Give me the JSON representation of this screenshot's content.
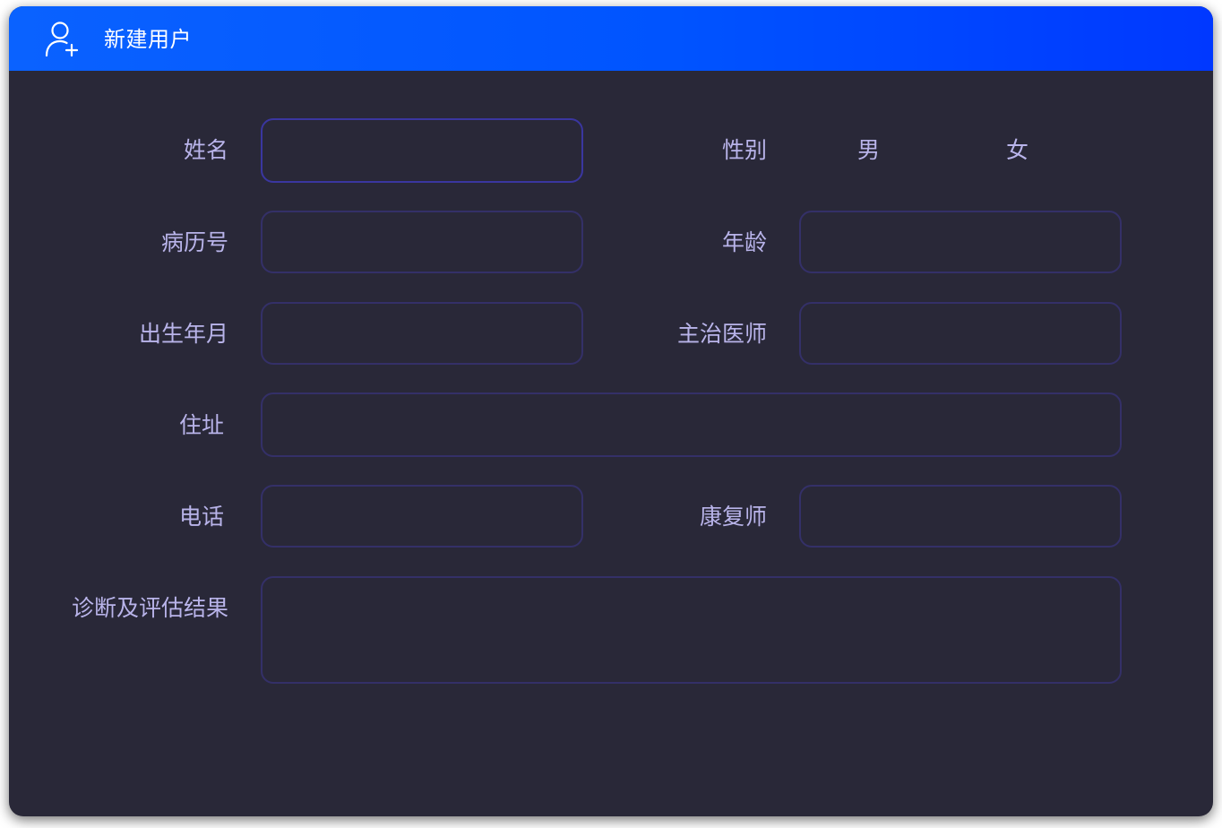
{
  "dialog": {
    "title": "新建用户",
    "title_icon": "add-user-icon"
  },
  "form": {
    "name": {
      "label": "姓名",
      "value": ""
    },
    "gender": {
      "label": "性别",
      "options": [
        "男",
        "女"
      ]
    },
    "record_no": {
      "label": "病历号",
      "value": ""
    },
    "age": {
      "label": "年龄",
      "value": ""
    },
    "birth": {
      "label": "出生年月",
      "value": ""
    },
    "doctor": {
      "label": "主治医师",
      "value": ""
    },
    "address": {
      "label": "住址",
      "value": ""
    },
    "phone": {
      "label": "电话",
      "value": ""
    },
    "therapist": {
      "label": "康复师",
      "value": ""
    },
    "diagnosis": {
      "label": "诊断及评估结果",
      "value": ""
    }
  },
  "colors": {
    "header_gradient_start": "#0a62ff",
    "header_gradient_end": "#0038ff",
    "panel_background": "#292838",
    "label_text": "#b9b4ea",
    "field_border": "#343068"
  }
}
